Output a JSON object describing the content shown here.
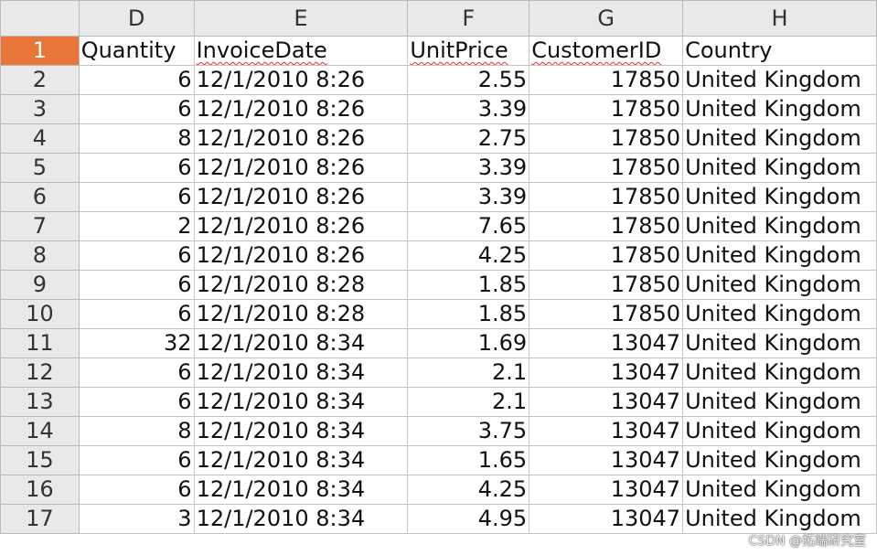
{
  "columns": [
    "D",
    "E",
    "F",
    "G",
    "H"
  ],
  "header_row": {
    "row_number": "1",
    "cells": [
      "Quantity",
      "InvoiceDate",
      "UnitPrice",
      "CustomerID",
      "Country"
    ]
  },
  "rows": [
    {
      "n": "2",
      "quantity": "6",
      "date": "12/1/2010 8:26",
      "price": "2.55",
      "customer": "17850",
      "country": "United Kingdom"
    },
    {
      "n": "3",
      "quantity": "6",
      "date": "12/1/2010 8:26",
      "price": "3.39",
      "customer": "17850",
      "country": "United Kingdom"
    },
    {
      "n": "4",
      "quantity": "8",
      "date": "12/1/2010 8:26",
      "price": "2.75",
      "customer": "17850",
      "country": "United Kingdom"
    },
    {
      "n": "5",
      "quantity": "6",
      "date": "12/1/2010 8:26",
      "price": "3.39",
      "customer": "17850",
      "country": "United Kingdom"
    },
    {
      "n": "6",
      "quantity": "6",
      "date": "12/1/2010 8:26",
      "price": "3.39",
      "customer": "17850",
      "country": "United Kingdom"
    },
    {
      "n": "7",
      "quantity": "2",
      "date": "12/1/2010 8:26",
      "price": "7.65",
      "customer": "17850",
      "country": "United Kingdom"
    },
    {
      "n": "8",
      "quantity": "6",
      "date": "12/1/2010 8:26",
      "price": "4.25",
      "customer": "17850",
      "country": "United Kingdom"
    },
    {
      "n": "9",
      "quantity": "6",
      "date": "12/1/2010 8:28",
      "price": "1.85",
      "customer": "17850",
      "country": "United Kingdom"
    },
    {
      "n": "10",
      "quantity": "6",
      "date": "12/1/2010 8:28",
      "price": "1.85",
      "customer": "17850",
      "country": "United Kingdom"
    },
    {
      "n": "11",
      "quantity": "32",
      "date": "12/1/2010 8:34",
      "price": "1.69",
      "customer": "13047",
      "country": "United Kingdom"
    },
    {
      "n": "12",
      "quantity": "6",
      "date": "12/1/2010 8:34",
      "price": "2.1",
      "customer": "13047",
      "country": "United Kingdom"
    },
    {
      "n": "13",
      "quantity": "6",
      "date": "12/1/2010 8:34",
      "price": "2.1",
      "customer": "13047",
      "country": "United Kingdom"
    },
    {
      "n": "14",
      "quantity": "8",
      "date": "12/1/2010 8:34",
      "price": "3.75",
      "customer": "13047",
      "country": "United Kingdom"
    },
    {
      "n": "15",
      "quantity": "6",
      "date": "12/1/2010 8:34",
      "price": "1.65",
      "customer": "13047",
      "country": "United Kingdom"
    },
    {
      "n": "16",
      "quantity": "6",
      "date": "12/1/2010 8:34",
      "price": "4.25",
      "customer": "13047",
      "country": "United Kingdom"
    },
    {
      "n": "17",
      "quantity": "3",
      "date": "12/1/2010 8:34",
      "price": "4.95",
      "customer": "13047",
      "country": "United Kingdom"
    }
  ],
  "watermark": "CSDN @拓端研究室",
  "colors": {
    "active_row_header": "#e8763b",
    "header_bg": "#e9e9e9",
    "gridline": "#c4c4c4",
    "spellcheck_underline": "#e03030"
  }
}
